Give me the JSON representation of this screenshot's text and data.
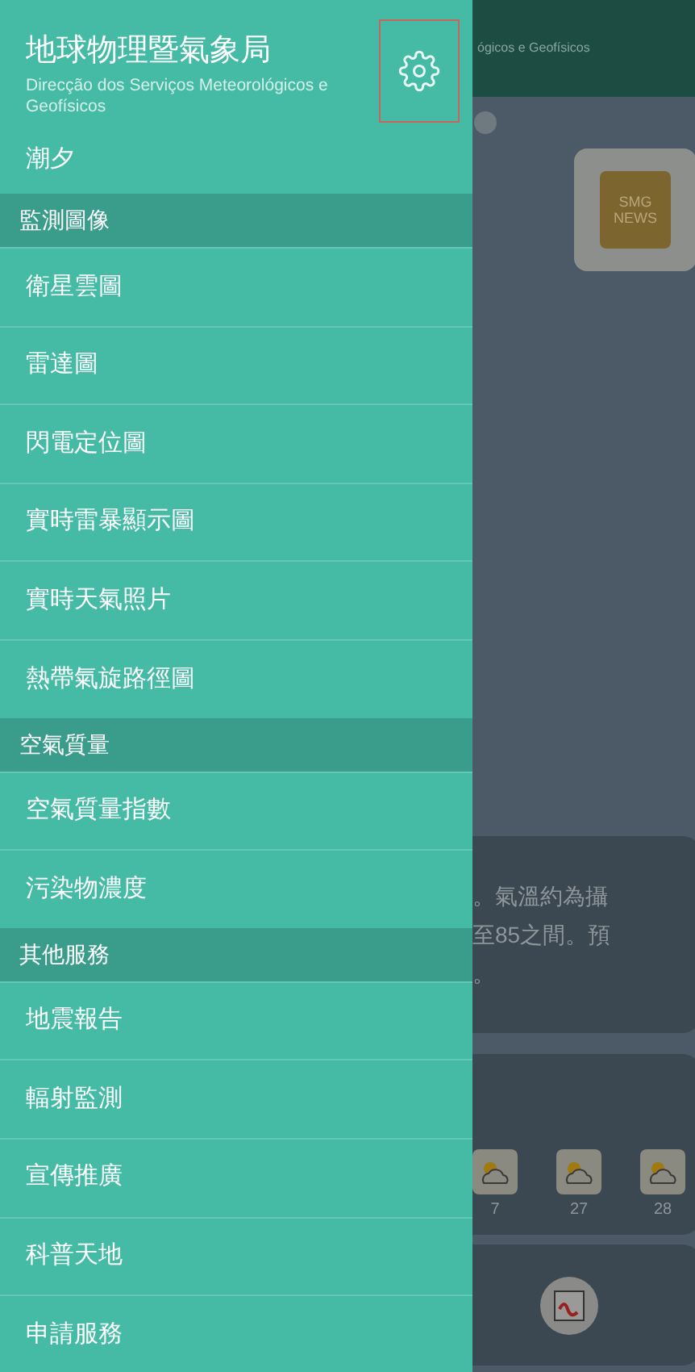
{
  "drawer": {
    "title": "地球物理暨氣象局",
    "subtitle": "Direcção dos Serviços Meteorológicos e Geofísicos",
    "settings": {
      "highlighted": true
    },
    "items": [
      {
        "kind": "item",
        "label": "潮夕"
      },
      {
        "kind": "section",
        "label": "監測圖像"
      },
      {
        "kind": "item",
        "label": "衛星雲圖"
      },
      {
        "kind": "item",
        "label": "雷達圖"
      },
      {
        "kind": "item",
        "label": "閃電定位圖"
      },
      {
        "kind": "item",
        "label": "實時雷暴顯示圖"
      },
      {
        "kind": "item",
        "label": "實時天氣照片"
      },
      {
        "kind": "item",
        "label": "熱帶氣旋路徑圖"
      },
      {
        "kind": "section",
        "label": "空氣質量"
      },
      {
        "kind": "item",
        "label": "空氣質量指數"
      },
      {
        "kind": "item",
        "label": "污染物濃度"
      },
      {
        "kind": "section",
        "label": "其他服務"
      },
      {
        "kind": "item",
        "label": "地震報告"
      },
      {
        "kind": "item",
        "label": "輻射監測"
      },
      {
        "kind": "item",
        "label": "宣傳推廣"
      },
      {
        "kind": "item",
        "label": "科普天地"
      },
      {
        "kind": "item",
        "label": "申請服務"
      }
    ]
  },
  "background": {
    "header_text": "ógicos e Geofísicos",
    "news_badge": [
      "SMG",
      "NEWS"
    ],
    "forecast_lines": [
      "。氣溫約為攝",
      "至85之間。預",
      "。"
    ],
    "temperatures": [
      "7",
      "27",
      "28"
    ]
  }
}
